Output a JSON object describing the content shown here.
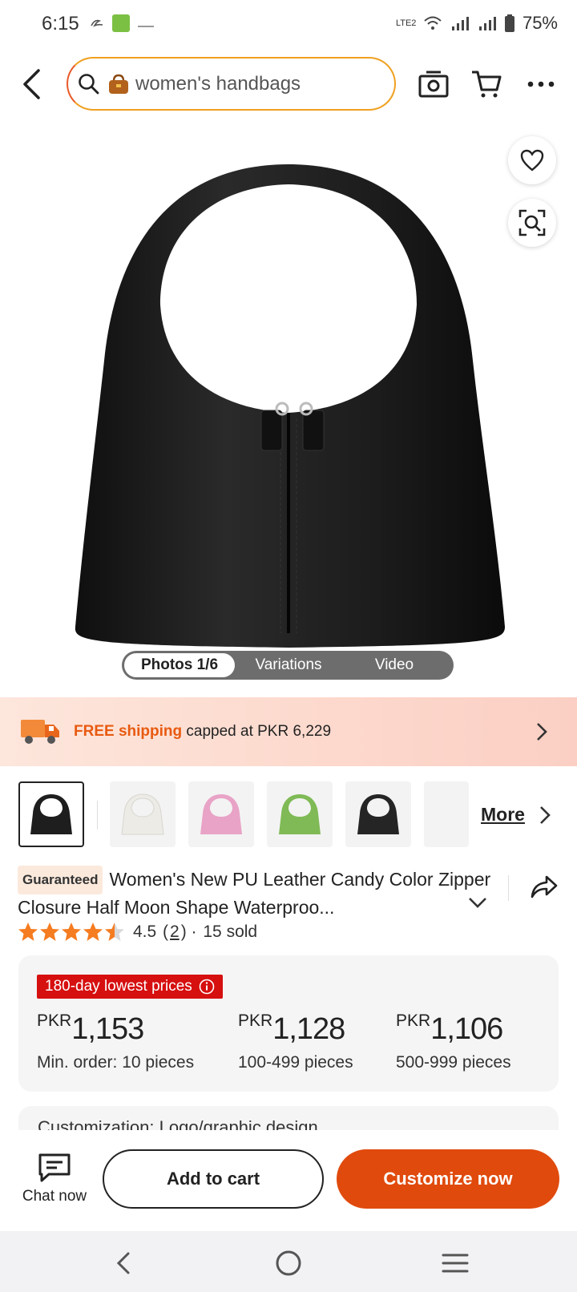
{
  "status_bar": {
    "time": "6:15",
    "network": "LTE2",
    "battery": "75%"
  },
  "header": {
    "search_text": "women's handbags",
    "icons": [
      "back-icon",
      "search-icon",
      "bag-emoji",
      "camera-icon",
      "cart-icon",
      "more-icon"
    ]
  },
  "media": {
    "tabs": [
      "Photos 1/6",
      "Variations",
      "Video"
    ]
  },
  "shipping": {
    "highlight": "FREE shipping",
    "rest": " capped at PKR 6,229"
  },
  "thumbnails": {
    "colors": [
      "#1e1e1e",
      "#ecebe6",
      "#e8a3c6",
      "#7fba56",
      "#252525",
      "#f2f2f2"
    ],
    "more_label": "More"
  },
  "product": {
    "badge": "Guaranteed",
    "title": "Women's New PU Leather Candy Color Zipper Closure Half Moon Shape Waterproo...",
    "rating": "4.5",
    "rating_count": "2",
    "sold": "15 sold"
  },
  "pricing": {
    "badge": "180-day lowest prices",
    "currency": "PKR",
    "tiers": [
      {
        "amount": "1,153",
        "qty": "Min. order: 10 pieces"
      },
      {
        "amount": "1,128",
        "qty": "100-499 pieces"
      },
      {
        "amount": "1,106",
        "qty": "500-999 pieces"
      }
    ]
  },
  "customization_peek": "Customization: Logo/graphic design",
  "actions": {
    "chat_label": "Chat now",
    "cart_label": "Add to cart",
    "customize_label": "Customize now"
  },
  "colors": {
    "accent": "#e04a0c",
    "highlight": "#e85a10",
    "badge_red": "#d60f0f",
    "star": "#f57c20"
  }
}
